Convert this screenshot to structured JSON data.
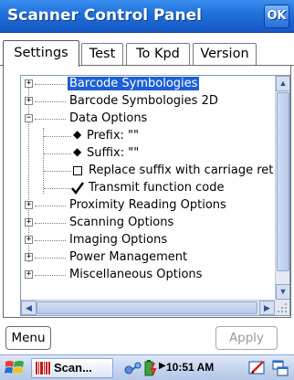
{
  "window": {
    "title": "Scanner Control Panel",
    "ok_label": "OK"
  },
  "tabs": [
    {
      "label": "Settings",
      "active": true
    },
    {
      "label": "Test",
      "active": false
    },
    {
      "label": "To Kpd",
      "active": false
    },
    {
      "label": "Version",
      "active": false
    }
  ],
  "tree": {
    "items": [
      {
        "label": "Barcode Symbologies",
        "expander": "+",
        "selected": true
      },
      {
        "label": "Barcode Symbologies 2D",
        "expander": "+"
      },
      {
        "label": "Data Options",
        "expander": "−"
      },
      {
        "label": "Prefix: \"\"",
        "marker": "◆"
      },
      {
        "label": "Suffix: \"\"",
        "marker": "◆"
      },
      {
        "label": "Replace suffix with carriage ret",
        "checkbox": "unchecked"
      },
      {
        "label": "Transmit function code",
        "checkbox": "checked"
      },
      {
        "label": "Proximity Reading Options",
        "expander": "+"
      },
      {
        "label": "Scanning Options",
        "expander": "+"
      },
      {
        "label": "Imaging Options",
        "expander": "+"
      },
      {
        "label": "Power Management",
        "expander": "+"
      },
      {
        "label": "Miscellaneous Options",
        "expander": "+"
      }
    ]
  },
  "buttons": {
    "menu": "Menu",
    "apply": "Apply"
  },
  "taskbar": {
    "app_label": "Scan...",
    "clock": "10:51 AM"
  },
  "colors": {
    "titlebar": "#1f6fd8",
    "selection": "#1c5fd8",
    "taskbar": "#c7d6ef"
  },
  "icons": [
    "windows-flag-icon",
    "barcode-app-icon",
    "network-icon",
    "battery-icon",
    "arrow-icon",
    "edit-icon",
    "window-switch-icon"
  ]
}
